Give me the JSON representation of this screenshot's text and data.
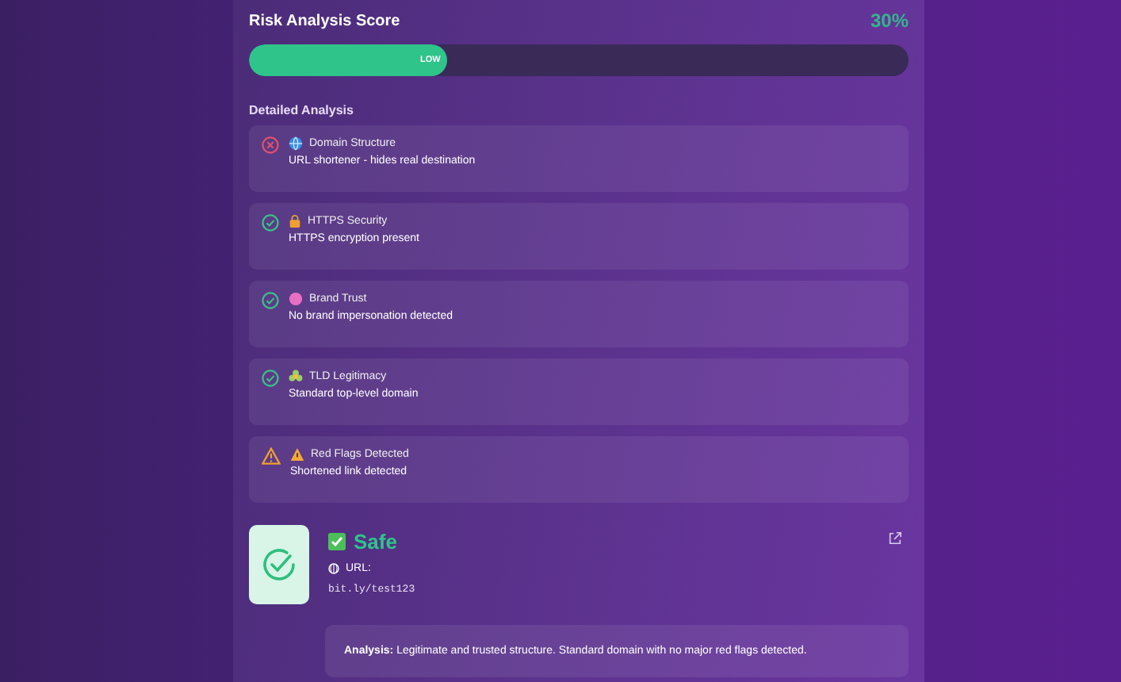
{
  "risk": {
    "title": "Risk Analysis Score",
    "score": "30%",
    "level": 0.3,
    "label": "LOW"
  },
  "details": {
    "heading": "Detailed Analysis",
    "checks": [
      {
        "kind": "fail",
        "title": "Domain Structure",
        "description": "URL shortener - hides real destination"
      },
      {
        "kind": "pass",
        "title": "HTTPS Security",
        "description": "HTTPS encryption present"
      },
      {
        "kind": "pass",
        "title": "Brand Trust",
        "description": "No brand impersonation detected"
      },
      {
        "kind": "pass",
        "title": "TLD Legitimacy",
        "description": "Standard top-level domain"
      },
      {
        "kind": "warn",
        "title": "Red Flags Detected",
        "description": "Shortened link detected"
      }
    ]
  },
  "result": {
    "verdict": "Safe",
    "url_label": "URL:",
    "url": "bit.ly/test123",
    "analysis": "**Analysis:** Legitimate and trusted structure. Standard domain with no major red flags detected."
  }
}
